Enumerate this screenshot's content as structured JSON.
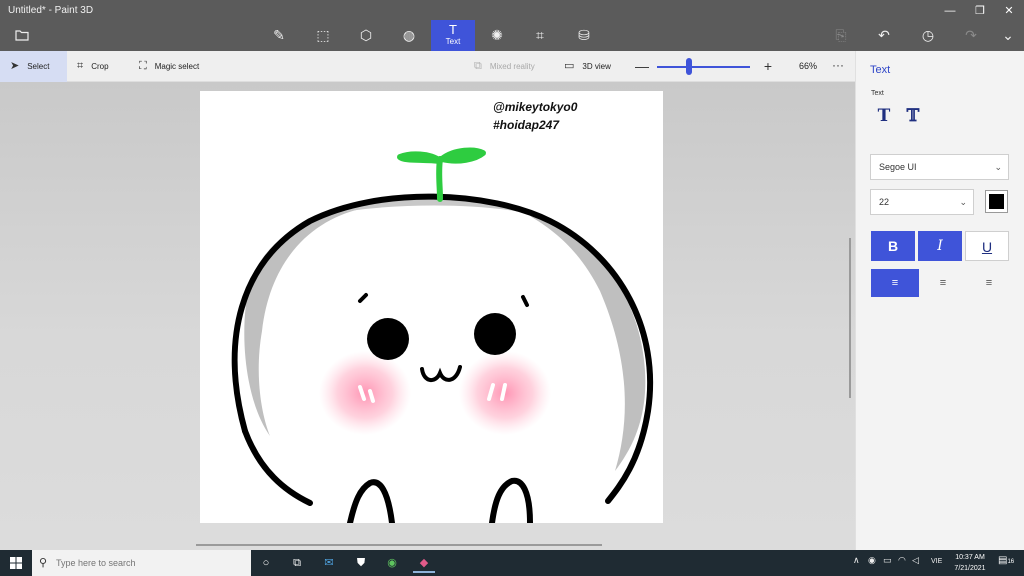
{
  "window": {
    "title": "Untitled* - Paint 3D",
    "controls": {
      "minimize": "—",
      "restore": "❐",
      "close": "✕"
    }
  },
  "toolbar": {
    "menu_icon": "folder-icon",
    "tools": [
      {
        "name": "brushes",
        "icon": "brush-icon",
        "glyph": "✎"
      },
      {
        "name": "2d-shapes",
        "icon": "2d-shapes-icon",
        "glyph": "⬚"
      },
      {
        "name": "3d-shapes",
        "icon": "3d-shapes-icon",
        "glyph": "⬡"
      },
      {
        "name": "stickers",
        "icon": "stickers-icon",
        "glyph": "◍"
      },
      {
        "name": "text",
        "icon": "text-icon",
        "glyph": "T",
        "label": "Text",
        "active": true
      },
      {
        "name": "effects",
        "icon": "effects-icon",
        "glyph": "✺"
      },
      {
        "name": "canvas",
        "icon": "canvas-icon",
        "glyph": "⌗"
      },
      {
        "name": "3d-library",
        "icon": "3d-library-icon",
        "glyph": "⛁"
      }
    ],
    "right_actions": [
      {
        "name": "paste",
        "icon": "paste-icon",
        "glyph": "⎘",
        "enabled": false
      },
      {
        "name": "undo",
        "icon": "undo-icon",
        "glyph": "↶",
        "enabled": true
      },
      {
        "name": "history",
        "icon": "history-icon",
        "glyph": "◷",
        "enabled": true
      },
      {
        "name": "redo",
        "icon": "redo-icon",
        "glyph": "↷",
        "enabled": false
      },
      {
        "name": "expand",
        "icon": "chevron-down-icon",
        "glyph": "⌄",
        "enabled": true
      }
    ]
  },
  "commandbar": {
    "select": "Select",
    "crop": "Crop",
    "magic_select": "Magic select",
    "mixed_reality": "Mixed reality",
    "view_3d": "3D view",
    "zoom_minus": "—",
    "zoom_plus": "+",
    "zoom_value": "66%",
    "zoom_level_percent": 66,
    "more": "···"
  },
  "canvas": {
    "text_line1": "@mikeytokyo0",
    "text_line2": "#hoidap247"
  },
  "panel": {
    "title": "Text",
    "subtitle": "Text",
    "text_types": [
      {
        "name": "2d-text",
        "glyph": "T"
      },
      {
        "name": "3d-text",
        "glyph": "𝕋"
      }
    ],
    "font_family": "Segoe UI",
    "font_size": "22",
    "text_color": "#000000",
    "format": {
      "bold": "B",
      "italic": "I",
      "underline": "U"
    },
    "align": {
      "left": "≡",
      "center": "≡",
      "right": "≡"
    }
  },
  "taskbar": {
    "search_placeholder": "Type here to search",
    "apps": [
      {
        "name": "cortana",
        "glyph": "○"
      },
      {
        "name": "task-view",
        "glyph": "⧉"
      },
      {
        "name": "mail",
        "glyph": "✉"
      },
      {
        "name": "store",
        "glyph": "⛊"
      },
      {
        "name": "chrome",
        "glyph": "◉"
      },
      {
        "name": "paint-3d",
        "glyph": "◆"
      }
    ],
    "tray": {
      "chevron": "∧",
      "language": "VIE"
    },
    "time": "10:37 AM",
    "date": "7/21/2021",
    "notification_count": "16"
  },
  "colors": {
    "accent": "#3f54d9",
    "titlebar": "#5b5b5b",
    "taskbar": "#1f2b33",
    "leaf_green": "#2ecc40",
    "blush_pink": "#ff9fb8"
  }
}
